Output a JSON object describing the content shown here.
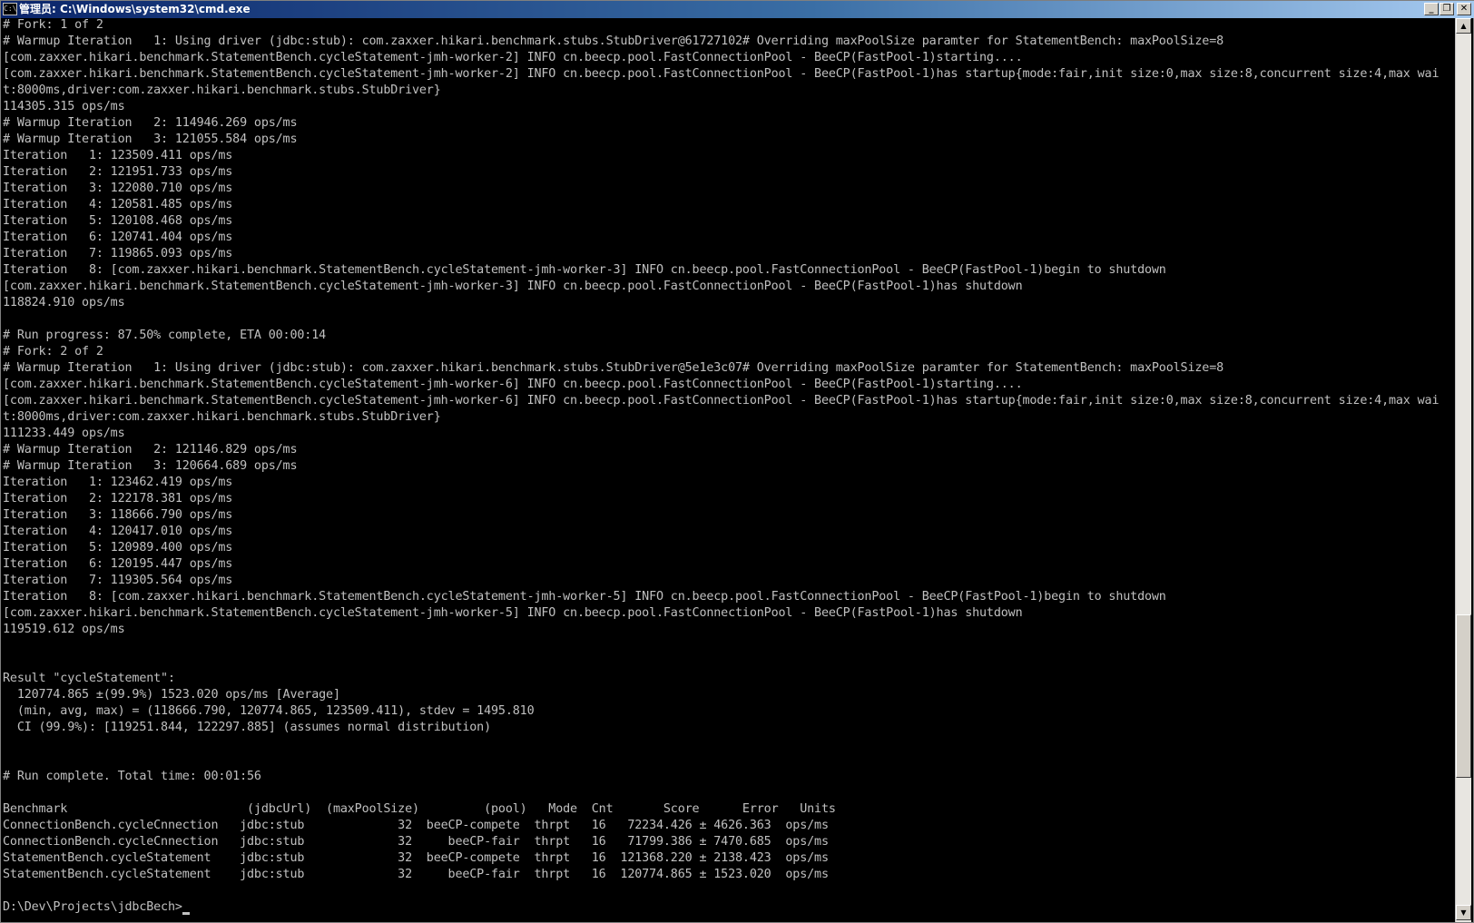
{
  "window": {
    "title": "管理员: C:\\Windows\\system32\\cmd.exe",
    "icon": "cmd-icon",
    "controls": {
      "minimize": "_",
      "maximize": "❐",
      "close": "✕"
    }
  },
  "scrollbar": {
    "up": "▲",
    "down": "▼",
    "position": 0.82
  },
  "console": {
    "lines": [
      "# Fork: 1 of 2",
      "# Warmup Iteration   1: Using driver (jdbc:stub): com.zaxxer.hikari.benchmark.stubs.StubDriver@61727102# Overriding maxPoolSize paramter for StatementBench: maxPoolSize=8",
      "[com.zaxxer.hikari.benchmark.StatementBench.cycleStatement-jmh-worker-2] INFO cn.beecp.pool.FastConnectionPool - BeeCP(FastPool-1)starting....",
      "[com.zaxxer.hikari.benchmark.StatementBench.cycleStatement-jmh-worker-2] INFO cn.beecp.pool.FastConnectionPool - BeeCP(FastPool-1)has startup{mode:fair,init size:0,max size:8,concurrent size:4,max wai",
      "t:8000ms,driver:com.zaxxer.hikari.benchmark.stubs.StubDriver}",
      "114305.315 ops/ms",
      "# Warmup Iteration   2: 114946.269 ops/ms",
      "# Warmup Iteration   3: 121055.584 ops/ms",
      "Iteration   1: 123509.411 ops/ms",
      "Iteration   2: 121951.733 ops/ms",
      "Iteration   3: 122080.710 ops/ms",
      "Iteration   4: 120581.485 ops/ms",
      "Iteration   5: 120108.468 ops/ms",
      "Iteration   6: 120741.404 ops/ms",
      "Iteration   7: 119865.093 ops/ms",
      "Iteration   8: [com.zaxxer.hikari.benchmark.StatementBench.cycleStatement-jmh-worker-3] INFO cn.beecp.pool.FastConnectionPool - BeeCP(FastPool-1)begin to shutdown",
      "[com.zaxxer.hikari.benchmark.StatementBench.cycleStatement-jmh-worker-3] INFO cn.beecp.pool.FastConnectionPool - BeeCP(FastPool-1)has shutdown",
      "118824.910 ops/ms",
      "",
      "# Run progress: 87.50% complete, ETA 00:00:14",
      "# Fork: 2 of 2",
      "# Warmup Iteration   1: Using driver (jdbc:stub): com.zaxxer.hikari.benchmark.stubs.StubDriver@5e1e3c07# Overriding maxPoolSize paramter for StatementBench: maxPoolSize=8",
      "[com.zaxxer.hikari.benchmark.StatementBench.cycleStatement-jmh-worker-6] INFO cn.beecp.pool.FastConnectionPool - BeeCP(FastPool-1)starting....",
      "[com.zaxxer.hikari.benchmark.StatementBench.cycleStatement-jmh-worker-6] INFO cn.beecp.pool.FastConnectionPool - BeeCP(FastPool-1)has startup{mode:fair,init size:0,max size:8,concurrent size:4,max wai",
      "t:8000ms,driver:com.zaxxer.hikari.benchmark.stubs.StubDriver}",
      "111233.449 ops/ms",
      "# Warmup Iteration   2: 121146.829 ops/ms",
      "# Warmup Iteration   3: 120664.689 ops/ms",
      "Iteration   1: 123462.419 ops/ms",
      "Iteration   2: 122178.381 ops/ms",
      "Iteration   3: 118666.790 ops/ms",
      "Iteration   4: 120417.010 ops/ms",
      "Iteration   5: 120989.400 ops/ms",
      "Iteration   6: 120195.447 ops/ms",
      "Iteration   7: 119305.564 ops/ms",
      "Iteration   8: [com.zaxxer.hikari.benchmark.StatementBench.cycleStatement-jmh-worker-5] INFO cn.beecp.pool.FastConnectionPool - BeeCP(FastPool-1)begin to shutdown",
      "[com.zaxxer.hikari.benchmark.StatementBench.cycleStatement-jmh-worker-5] INFO cn.beecp.pool.FastConnectionPool - BeeCP(FastPool-1)has shutdown",
      "119519.612 ops/ms",
      "",
      "",
      "Result \"cycleStatement\":",
      "  120774.865 ±(99.9%) 1523.020 ops/ms [Average]",
      "  (min, avg, max) = (118666.790, 120774.865, 123509.411), stdev = 1495.810",
      "  CI (99.9%): [119251.844, 122297.885] (assumes normal distribution)",
      "",
      "",
      "# Run complete. Total time: 00:01:56",
      "",
      "Benchmark                         (jdbcUrl)  (maxPoolSize)         (pool)   Mode  Cnt       Score      Error   Units",
      "ConnectionBench.cycleCnnection   jdbc:stub             32  beeCP-compete  thrpt   16   72234.426 ± 4626.363  ops/ms",
      "ConnectionBench.cycleCnnection   jdbc:stub             32     beeCP-fair  thrpt   16   71799.386 ± 7470.685  ops/ms",
      "StatementBench.cycleStatement    jdbc:stub             32  beeCP-compete  thrpt   16  121368.220 ± 2138.423  ops/ms",
      "StatementBench.cycleStatement    jdbc:stub             32     beeCP-fair  thrpt   16  120774.865 ± 1523.020  ops/ms",
      "",
      "D:\\Dev\\Projects\\jdbcBech>"
    ]
  }
}
